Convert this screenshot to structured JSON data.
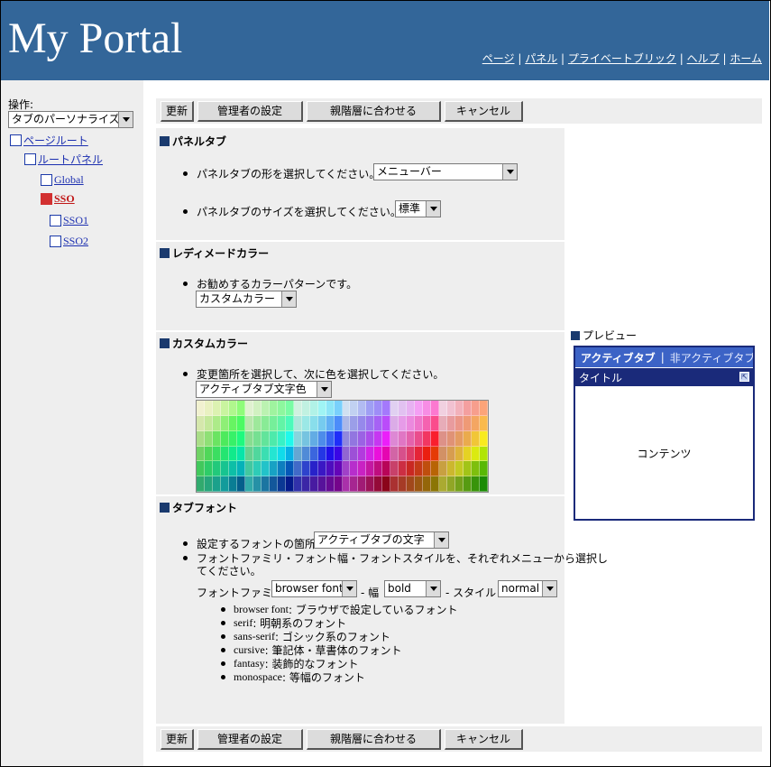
{
  "header": {
    "title": "My Portal",
    "nav": [
      "ページ",
      "パネル",
      "プライベートブリック",
      "ヘルプ",
      "ホーム"
    ],
    "nav_separator": "|",
    "background": "#336699"
  },
  "sidebar": {
    "operation_label": "操作:",
    "operation_select": "タブのパーソナライズ",
    "tree": [
      {
        "label": "ページルート"
      },
      {
        "label": "ルートパネル"
      },
      {
        "label": "Global"
      },
      {
        "label": "SSO",
        "active": true
      },
      {
        "label": "SSO1"
      },
      {
        "label": "SSO2"
      }
    ]
  },
  "buttons": {
    "refresh": "更新",
    "admin_settings": "管理者の設定",
    "match_parent": "親階層に合わせる",
    "cancel": "キャンセル"
  },
  "panel_tab": {
    "title": "パネルタブ",
    "shape_prompt": "パネルタブの形を選択してください。",
    "shape_value": "メニューバー",
    "size_prompt": "パネルタブのサイズを選択してください。",
    "size_value": "標準"
  },
  "ready_made": {
    "title": "レディメードカラー",
    "prompt": "お勧めするカラーパターンです。",
    "value": "カスタムカラー"
  },
  "custom_color": {
    "title": "カスタムカラー",
    "prompt": "変更箇所を選択して、次に色を選択してください。",
    "target_value": "アクティブタブ文字色"
  },
  "tab_font": {
    "title": "タブフォント",
    "target_prompt": "設定するフォントの箇所",
    "target_value": "アクティブタブの文字",
    "family_prompt_line1": "フォントファミリ・フォント幅・フォントスタイルを、それぞれメニューから選択し",
    "family_prompt_line2": "てください。",
    "family_label": "フォントファミリ",
    "family_value": "browser font",
    "weight_label": "- 幅",
    "weight_value": "bold",
    "style_label": "- スタイル",
    "style_value": "normal",
    "descriptions": [
      {
        "name": "browser font",
        "desc": " : ブラウザで設定しているフォント"
      },
      {
        "name": "serif",
        "desc": " : 明朝系のフォント"
      },
      {
        "name": "sans-serif",
        "desc": " : ゴシック系のフォント"
      },
      {
        "name": "cursive",
        "desc": " : 筆記体・草書体のフォント"
      },
      {
        "name": "fantasy",
        "desc": " : 装飾的なフォント"
      },
      {
        "name": "monospace",
        "desc": " : 等幅のフォント"
      }
    ]
  },
  "preview": {
    "label": "プレビュー",
    "active_tab": "アクティブタブ",
    "separator": "|",
    "inactive_tab": "非アクティブタブ",
    "title": "タイトル",
    "content": "コンテンツ",
    "tab_color": "#3c63c6",
    "title_color": "#1a2a7a"
  }
}
